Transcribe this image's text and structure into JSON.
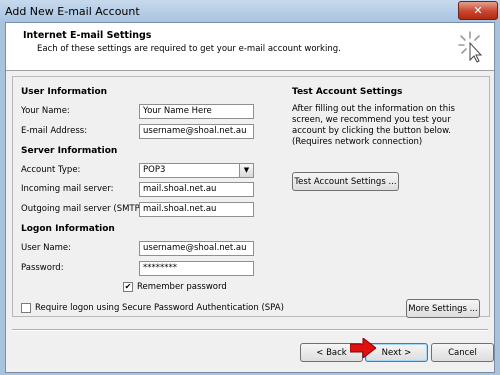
{
  "window": {
    "title": "Add New E-mail Account",
    "close_glyph": "✕"
  },
  "header": {
    "title": "Internet E-mail Settings",
    "subtitle": "Each of these settings are required to get your e-mail account working.",
    "icon": "sparkle-cursor-icon"
  },
  "user_info": {
    "section": "User Information",
    "name_label": "Your Name:",
    "name_value": "Your Name Here",
    "email_label": "E-mail Address:",
    "email_value": "username@shoal.net.au"
  },
  "server_info": {
    "section": "Server Information",
    "account_type_label": "Account Type:",
    "account_type_value": "POP3",
    "incoming_label": "Incoming mail server:",
    "incoming_value": "mail.shoal.net.au",
    "outgoing_label": "Outgoing mail server (SMTP):",
    "outgoing_value": "mail.shoal.net.au"
  },
  "logon_info": {
    "section": "Logon Information",
    "username_label": "User Name:",
    "username_value": "username@shoal.net.au",
    "password_label": "Password:",
    "password_value": "********",
    "remember_label": "Remember password",
    "remember_checked": true,
    "spa_label": "Require logon using Secure Password Authentication (SPA)",
    "spa_checked": false
  },
  "test": {
    "section": "Test Account Settings",
    "description": "After filling out the information on this screen, we recommend you test your account by clicking the button below. (Requires network connection)",
    "button": "Test Account Settings ..."
  },
  "buttons": {
    "more_settings": "More Settings ...",
    "back": "< Back",
    "next": "Next >",
    "cancel": "Cancel"
  },
  "colors": {
    "arrow": "#e01010",
    "titlebar": "#b6cde6",
    "close": "#c9452d"
  }
}
